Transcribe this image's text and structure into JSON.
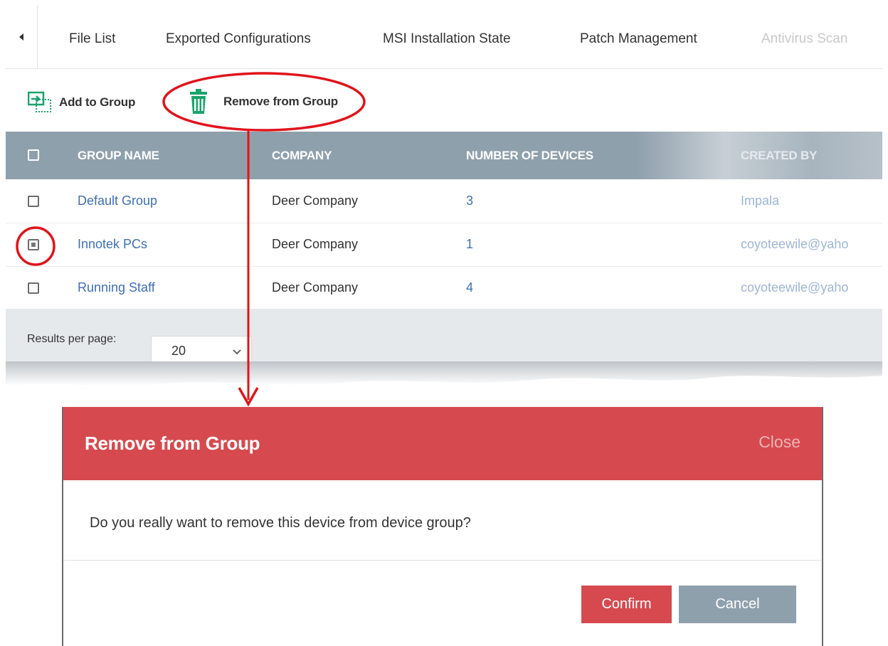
{
  "tabs": {
    "items": [
      "File List",
      "Exported Configurations",
      "MSI Installation State",
      "Patch Management",
      "Antivirus Scan"
    ]
  },
  "toolbar": {
    "add_label": "Add to Group",
    "remove_label": "Remove from Group",
    "add_icon": "add-to-group-icon",
    "remove_icon": "trash-icon",
    "accent": "#1aa36b"
  },
  "table": {
    "columns": [
      "GROUP NAME",
      "COMPANY",
      "NUMBER OF DEVICES",
      "CREATED BY"
    ],
    "rows": [
      {
        "name": "Default Group",
        "company": "Deer Company",
        "devices": "3",
        "created_by": "Impala",
        "checked": false
      },
      {
        "name": "Innotek PCs",
        "company": "Deer Company",
        "devices": "1",
        "created_by": "coyoteewile@yaho",
        "checked": true
      },
      {
        "name": "Running Staff",
        "company": "Deer Company",
        "devices": "4",
        "created_by": "coyoteewile@yaho",
        "checked": false
      }
    ]
  },
  "pagination": {
    "label": "Results per page:",
    "value": "20"
  },
  "modal": {
    "title": "Remove from Group",
    "close_label": "Close",
    "message": "Do you really want to remove this device from device group?",
    "confirm_label": "Confirm",
    "cancel_label": "Cancel"
  },
  "colors": {
    "header_bg": "#8fa0ad",
    "modal_red": "#d64a4f",
    "link_blue": "#3f6fb8",
    "annotation_red": "#e0141b"
  }
}
